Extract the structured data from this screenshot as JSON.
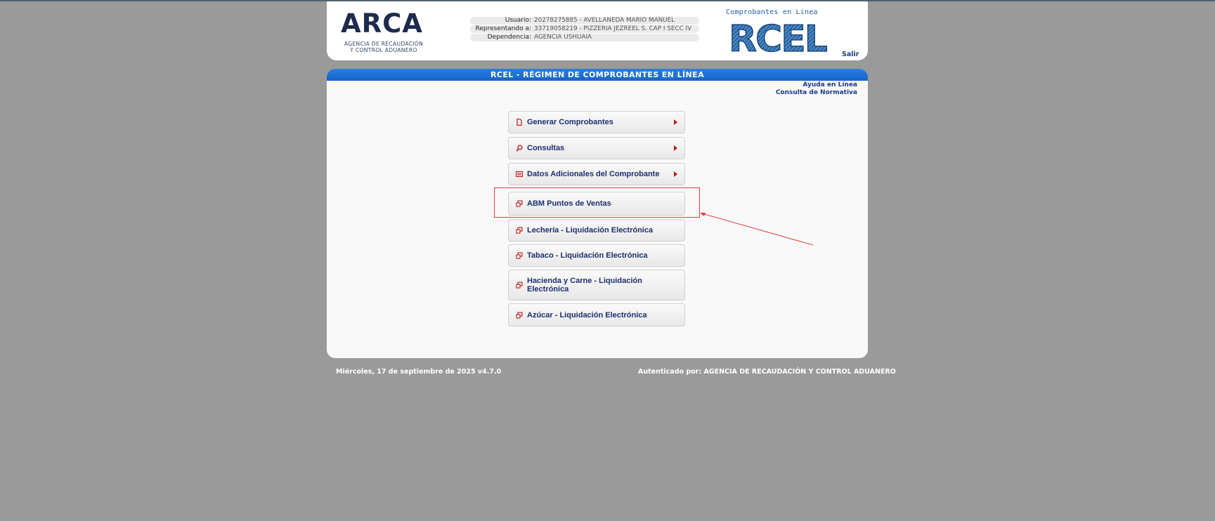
{
  "header": {
    "logo": {
      "name": "ARCA",
      "subtitle_line1": "AGENCIA DE RECAUDACIÓN",
      "subtitle_line2": "Y CONTROL ADUANERO"
    },
    "user_info": [
      {
        "label": "Usuario:",
        "value": "20278275885 - AVELLANEDA MARIO MANUEL"
      },
      {
        "label": "Representando a:",
        "value": "33719058219 - PIZZERIA JEZREEL S. CAP I SECC IV"
      },
      {
        "label": "Dependencia:",
        "value": "AGENCIA USHUAIA"
      }
    ],
    "rcel_logo": {
      "caption": "Comprobantes en Linea",
      "mark": "RCEL"
    },
    "logout_label": "Salir"
  },
  "main": {
    "title": "RCEL - RÉGIMEN DE COMPROBANTES EN LÍNEA",
    "help_links": [
      "Ayuda en Línea",
      "Consulta de Normativa"
    ],
    "menu": [
      {
        "label": "Generar Comprobantes",
        "icon": "document-icon",
        "has_submenu": true
      },
      {
        "label": "Consultas",
        "icon": "search-icon",
        "has_submenu": true
      },
      {
        "label": "Datos Adicionales del Comprobante",
        "icon": "list-icon",
        "has_submenu": true
      },
      {
        "label": "ABM Puntos de Ventas",
        "icon": "window-icon",
        "has_submenu": false
      },
      {
        "label": "Lechería - Liquidación Electrónica",
        "icon": "window-icon",
        "has_submenu": false
      },
      {
        "label": "Tabaco - Liquidación Electrónica",
        "icon": "window-icon",
        "has_submenu": false
      },
      {
        "label": "Hacienda y Carne - Liquidación Electrónica",
        "icon": "window-icon",
        "has_submenu": false
      },
      {
        "label": "Azúcar - Liquidación Electrónica",
        "icon": "window-icon",
        "has_submenu": false
      }
    ]
  },
  "footer": {
    "date_version": "Miércoles, 17 de septiembre de 2025 v4.7.0",
    "authenticated_by": "Autenticado por: AGENCIA DE RECAUDACIÓN Y CONTROL ADUANERO"
  },
  "colors": {
    "background": "#9a9a9a",
    "title_bar": "#1a6fd6",
    "menu_text": "#1c2e6e",
    "icon_red": "#c01818",
    "annotation": "#e23b3b"
  }
}
